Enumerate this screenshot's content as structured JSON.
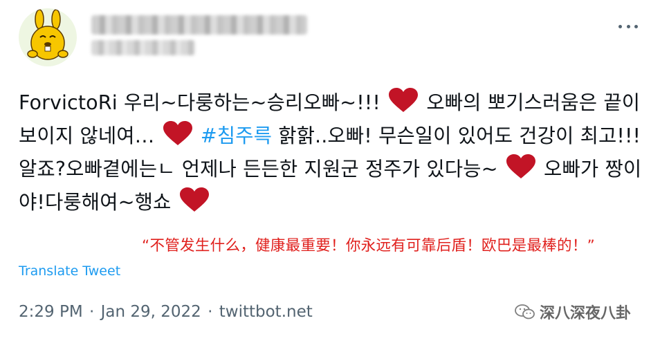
{
  "tweet": {
    "text": {
      "segment1": "ForvictoRi 우리~다룽하는~승리오빠~!!!",
      "segment2": " 오빠의 뽀기스러움은 끝이 보이지 않네여… ",
      "hashtag": "#침주륵",
      "segment3": " 핡핡..오빠! 무슨일이 있어도 건강이 최고!!!알죠?오빠곁에는ㄴ 언제나 든든한 지원군 정주가 있다능~",
      "segment4": "오빠가 짱이야!다룽해여~행쇼"
    },
    "translate_label": "Translate Tweet",
    "time": "2:29 PM",
    "date": "Jan 29, 2022",
    "source": "twittbot.net",
    "separator": "·"
  },
  "caption": "“不管发生什么，健康最重要！你永远有可靠后盾！欧巴是最棒的！”",
  "watermark": {
    "text": "深八深夜八卦"
  },
  "colors": {
    "heart": "#c21426",
    "link": "#1d9bf0",
    "caption": "#e0201d",
    "meta": "#536471"
  }
}
